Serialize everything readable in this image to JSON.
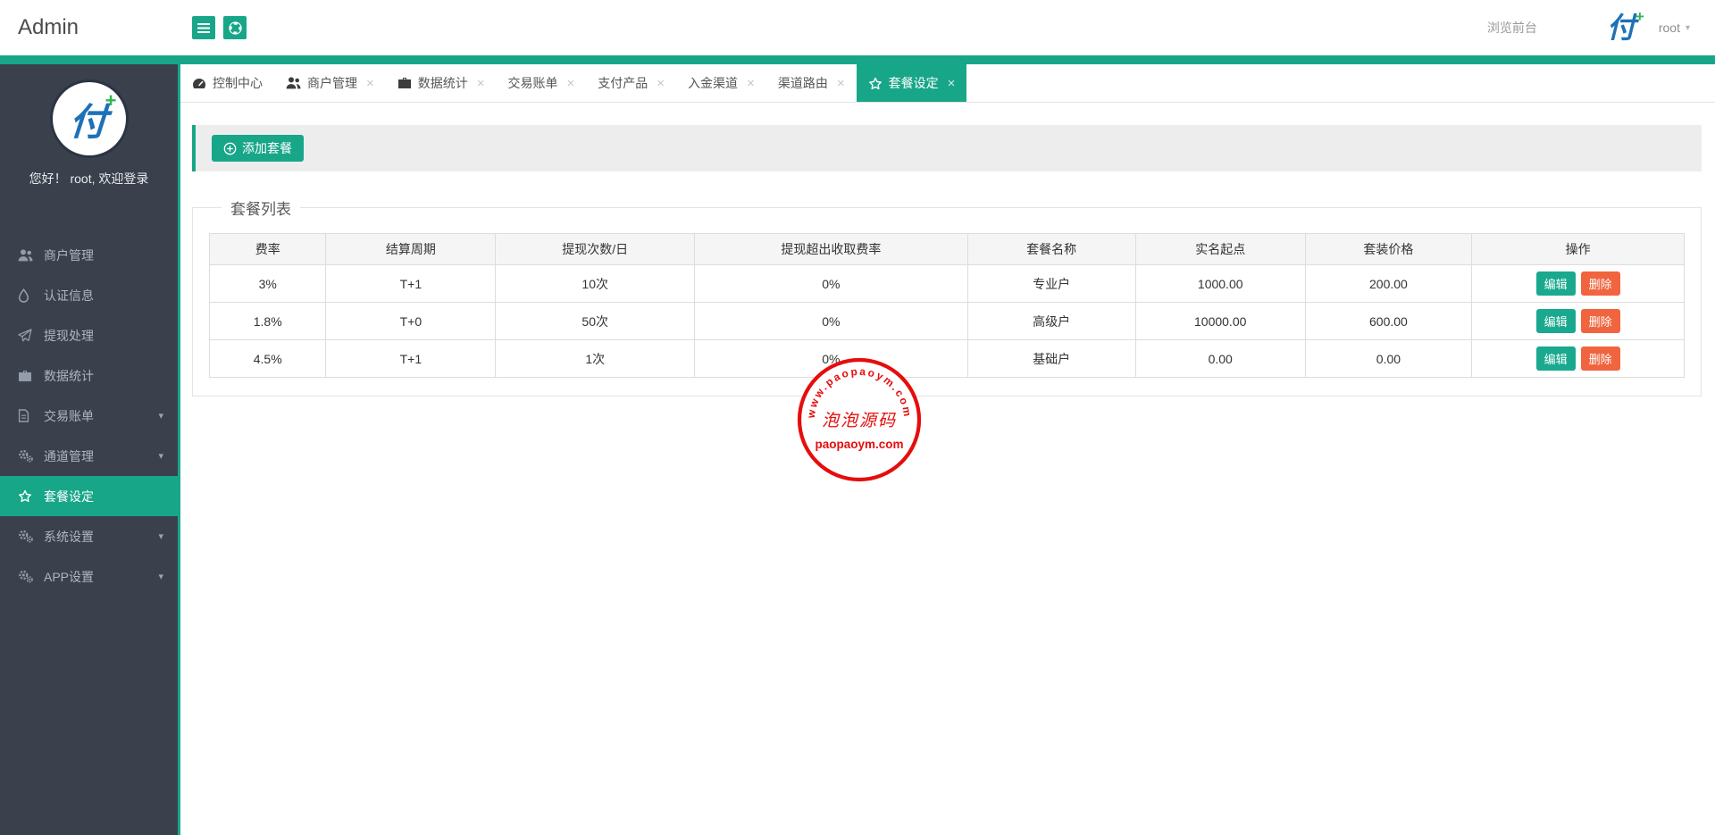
{
  "colors": {
    "accent_teal": "#18a689",
    "sidebar_bg": "#3a404c",
    "edit_teal": "#1aa98e",
    "delete_orange": "#f0653f",
    "stamp_red": "#e60d0d",
    "logo_blue": "#1d71b8",
    "logo_green": "#2eb84c"
  },
  "icons": {
    "close": "×",
    "caret_down": "▾",
    "brand_char": "付",
    "brand_plus": "+"
  },
  "header": {
    "brand": "Admin",
    "browse_front": "浏览前台",
    "username": "root"
  },
  "sidebar": {
    "greeting": "您好！ root, 欢迎登录",
    "items": [
      {
        "label": "商户管理",
        "icon": "users-icon",
        "caret": false,
        "active": false
      },
      {
        "label": "认证信息",
        "icon": "tint-icon",
        "caret": false,
        "active": false
      },
      {
        "label": "提现处理",
        "icon": "send-icon",
        "caret": false,
        "active": false
      },
      {
        "label": "数据统计",
        "icon": "briefcase-icon",
        "caret": false,
        "active": false
      },
      {
        "label": "交易账单",
        "icon": "file-icon",
        "caret": true,
        "active": false
      },
      {
        "label": "通道管理",
        "icon": "cogs-icon",
        "caret": true,
        "active": false
      },
      {
        "label": "套餐设定",
        "icon": "star-icon",
        "caret": false,
        "active": true
      },
      {
        "label": "系统设置",
        "icon": "cogs-icon",
        "caret": true,
        "active": false
      },
      {
        "label": "APP设置",
        "icon": "cogs-icon",
        "caret": true,
        "active": false
      }
    ]
  },
  "tabs": [
    {
      "label": "控制中心",
      "icon": "dashboard-icon",
      "closable": false,
      "active": false
    },
    {
      "label": "商户管理",
      "icon": "users-icon",
      "closable": true,
      "active": false
    },
    {
      "label": "数据统计",
      "icon": "briefcase-icon",
      "closable": true,
      "active": false
    },
    {
      "label": "交易账单",
      "icon": null,
      "closable": true,
      "active": false
    },
    {
      "label": "支付产品",
      "icon": null,
      "closable": true,
      "active": false
    },
    {
      "label": "入金渠道",
      "icon": null,
      "closable": true,
      "active": false
    },
    {
      "label": "渠道路由",
      "icon": null,
      "closable": true,
      "active": false
    },
    {
      "label": "套餐设定",
      "icon": "star-icon",
      "closable": true,
      "active": true
    }
  ],
  "toolbar": {
    "add_label": "添加套餐"
  },
  "panel": {
    "title": "套餐列表",
    "table": {
      "headers": [
        "费率",
        "结算周期",
        "提现次数/日",
        "提现超出收取费率",
        "套餐名称",
        "实名起点",
        "套装价格",
        "操作"
      ],
      "rows": [
        [
          "3%",
          "T+1",
          "10次",
          "0%",
          "专业户",
          "1000.00",
          "200.00"
        ],
        [
          "1.8%",
          "T+0",
          "50次",
          "0%",
          "高级户",
          "10000.00",
          "600.00"
        ],
        [
          "4.5%",
          "T+1",
          "1次",
          "0%",
          "基础户",
          "0.00",
          "0.00"
        ]
      ],
      "actions": {
        "edit": "编辑",
        "delete": "删除"
      }
    }
  },
  "watermark": {
    "arc_text": "www.paopaoym.com",
    "center_text": "泡泡源码",
    "bottom_text": "paopaoym.com"
  }
}
